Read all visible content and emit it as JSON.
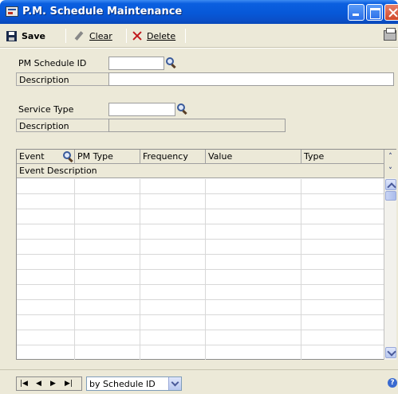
{
  "window": {
    "title": "P.M. Schedule Maintenance"
  },
  "toolbar": {
    "save_label": "Save",
    "clear_label": "Clear",
    "delete_label": "Delete"
  },
  "form": {
    "pm_schedule_id_label": "PM Schedule ID",
    "pm_schedule_id_value": "",
    "description_label": "Description",
    "description_value": "",
    "service_type_label": "Service Type",
    "service_type_value": "",
    "service_description_label": "Description",
    "service_description_value": ""
  },
  "grid": {
    "columns": [
      "Event",
      "PM Type",
      "Frequency",
      "Value",
      "Type"
    ],
    "subheader": "Event Description",
    "rows": [
      [
        "",
        "",
        "",
        "",
        ""
      ],
      [
        "",
        "",
        "",
        "",
        ""
      ],
      [
        "",
        "",
        "",
        "",
        ""
      ],
      [
        "",
        "",
        "",
        "",
        ""
      ],
      [
        "",
        "",
        "",
        "",
        ""
      ],
      [
        "",
        "",
        "",
        "",
        ""
      ],
      [
        "",
        "",
        "",
        "",
        ""
      ],
      [
        "",
        "",
        "",
        "",
        ""
      ],
      [
        "",
        "",
        "",
        "",
        ""
      ],
      [
        "",
        "",
        "",
        "",
        ""
      ],
      [
        "",
        "",
        "",
        "",
        ""
      ],
      [
        "",
        "",
        "",
        "",
        ""
      ]
    ]
  },
  "bottom": {
    "sort_by": "by Schedule ID"
  },
  "icons": {
    "title": "window-icon",
    "save": "save-icon",
    "clear": "eraser-icon",
    "delete": "delete-x-icon",
    "print": "printer-icon",
    "lookup": "magnifier-icon",
    "help": "help-icon"
  },
  "colors": {
    "titlebar": "#0758d8",
    "form_background": "#ece9d8",
    "delete_icon": "#c0181c"
  }
}
